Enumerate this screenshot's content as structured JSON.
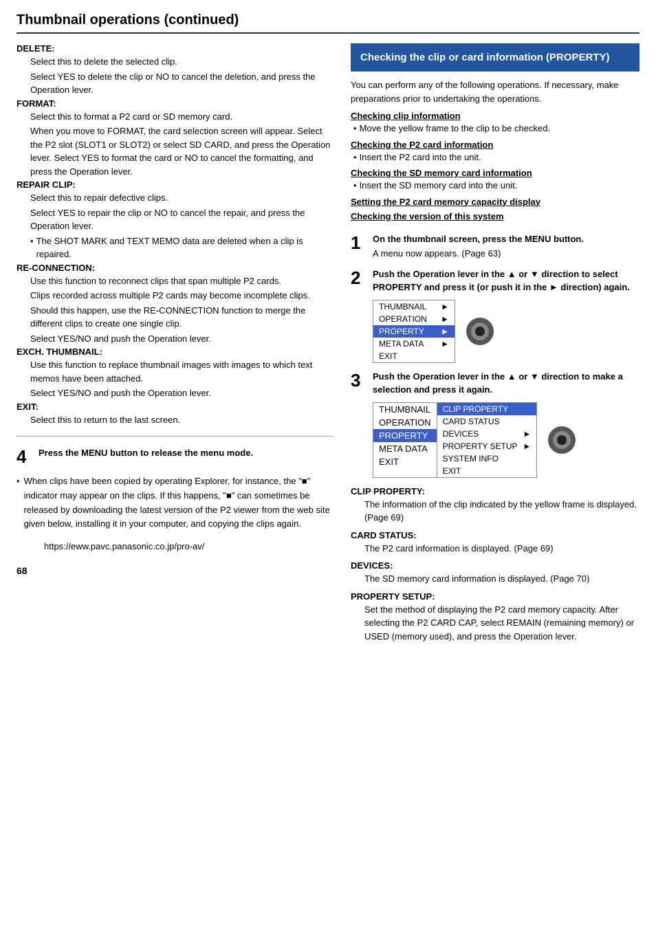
{
  "page": {
    "title": "Thumbnail operations (continued)",
    "footer_page": "68"
  },
  "left_col": {
    "sections": [
      {
        "label": "DELETE:",
        "texts": [
          "Select this to delete the selected clip.",
          "Select YES to delete the clip or NO to cancel the deletion, and press the Operation lever."
        ]
      },
      {
        "label": "FORMAT:",
        "texts": [
          "Select this to format a P2 card or SD memory card.",
          "When you move to FORMAT, the card selection screen will appear. Select the P2 slot (SLOT1 or SLOT2) or select SD CARD, and press the Operation lever. Select YES to format the card or NO to cancel the formatting, and press the Operation lever."
        ]
      },
      {
        "label": "REPAIR CLIP:",
        "texts": [
          "Select this to repair defective clips.",
          "Select YES to repair the clip or NO to cancel the repair, and press the Operation lever."
        ],
        "bullets": [
          "The SHOT MARK and TEXT MEMO data are deleted when a clip is repaired."
        ]
      },
      {
        "label": "RE-CONNECTION:",
        "texts": [
          "Use this function to reconnect clips that span multiple P2 cards.",
          "Clips recorded across multiple P2 cards may become incomplete clips.",
          "Should this happen, use the RE-CONNECTION function to merge the different clips to create one single clip.",
          "Select YES/NO and push the Operation lever."
        ]
      },
      {
        "label": "EXCH. THUMBNAIL:",
        "texts": [
          "Use this function to replace thumbnail images with images to which text memos have been attached.",
          "Select YES/NO and push the Operation lever."
        ]
      },
      {
        "label": "EXIT:",
        "texts": [
          "Select this to return to the last screen."
        ]
      }
    ],
    "step4": {
      "number": "4",
      "title": "Press the MENU button to release the menu mode."
    },
    "note": {
      "bullets": [
        "When clips have been copied by operating Explorer, for instance, the \"■\" indicator may appear on the clips. If this happens, \"■\" can sometimes be released by downloading the latest version of the P2 viewer from the web site given below, installing it in your computer, and copying the clips again."
      ]
    },
    "url": "https://eww.pavc.panasonic.co.jp/pro-av/"
  },
  "right_col": {
    "header": "Checking the clip or card information (PROPERTY)",
    "intro": "You can perform any of the following operations. If necessary, make preparations prior to undertaking the operations.",
    "check_items": [
      {
        "label": "Checking clip information",
        "bullet": "Move the yellow frame to the clip to be checked."
      },
      {
        "label": "Checking the P2 card information",
        "bullet": "Insert the P2 card into the unit."
      },
      {
        "label": "Checking the SD memory card information",
        "bullet": "Insert the SD memory card into the unit."
      },
      {
        "label": "Setting the P2 card memory capacity display",
        "bullet": null
      },
      {
        "label": "Checking the version of this system",
        "bullet": null
      }
    ],
    "step1": {
      "number": "1",
      "title": "On the thumbnail screen, press the MENU button.",
      "desc": "A menu now appears. (Page 63)"
    },
    "step2": {
      "number": "2",
      "title": "Push the Operation lever in the ▲ or ▼ direction to select PROPERTY and press it (or push it in the ► direction) again.",
      "menu": {
        "items": [
          {
            "label": "THUMBNAIL",
            "arrow": "►",
            "highlighted": false
          },
          {
            "label": "OPERATION",
            "arrow": "►",
            "highlighted": false
          },
          {
            "label": "PROPERTY",
            "arrow": "►",
            "highlighted": true
          },
          {
            "label": "META DATA",
            "arrow": "►",
            "highlighted": false
          },
          {
            "label": "EXIT",
            "arrow": "",
            "highlighted": false
          }
        ]
      }
    },
    "step3": {
      "number": "3",
      "title": "Push the Operation lever in the ▲ or ▼ direction to make a selection and press it again.",
      "menu": {
        "left_items": [
          {
            "label": "THUMBNAIL",
            "highlighted": false
          },
          {
            "label": "OPERATION",
            "highlighted": false
          },
          {
            "label": "PROPERTY",
            "highlighted": true
          },
          {
            "label": "META DATA",
            "highlighted": false
          },
          {
            "label": "EXIT",
            "highlighted": false
          }
        ],
        "right_items": [
          {
            "label": "CLIP PROPERTY",
            "highlighted": true
          },
          {
            "label": "CARD STATUS",
            "highlighted": false
          },
          {
            "label": "DEVICES",
            "arrow": "►",
            "highlighted": false
          },
          {
            "label": "PROPERTY SETUP",
            "arrow": "►",
            "highlighted": false
          },
          {
            "label": "SYSTEM INFO",
            "highlighted": false
          },
          {
            "label": "EXIT",
            "highlighted": false
          }
        ]
      }
    },
    "clip_sections": [
      {
        "label": "CLIP PROPERTY:",
        "text": "The information of the clip indicated by the yellow frame is displayed. (Page 69)"
      },
      {
        "label": "CARD STATUS:",
        "text": "The P2 card information is displayed. (Page 69)"
      },
      {
        "label": "DEVICES:",
        "text": "The SD memory card information is displayed. (Page 70)"
      },
      {
        "label": "PROPERTY SETUP:",
        "text": "Set the method of displaying the P2 card memory capacity. After selecting the P2 CARD CAP, select REMAIN (remaining memory) or USED (memory used), and press the Operation lever."
      }
    ]
  }
}
